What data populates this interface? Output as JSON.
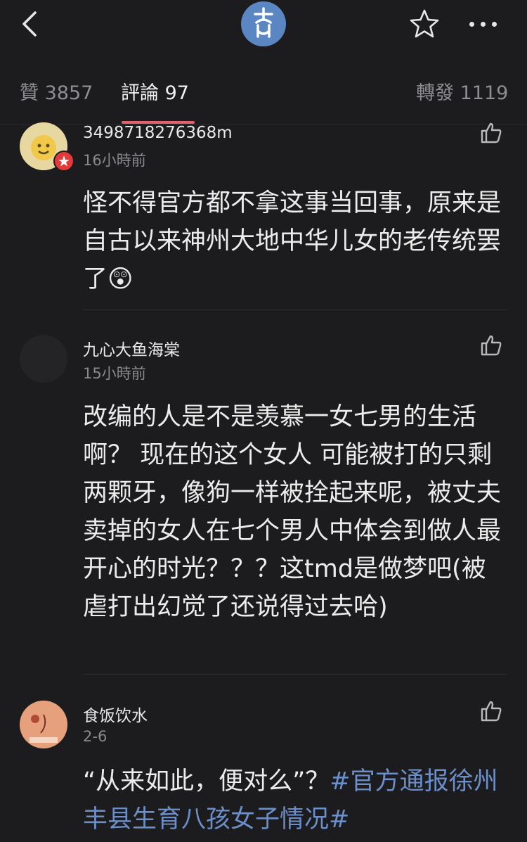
{
  "header": {
    "back_icon": "chevron-left-icon",
    "logo_icon": "weibo-logo-icon",
    "favorite_icon": "star-outline-icon",
    "more_icon": "more-horizontal-icon"
  },
  "tabs": [
    {
      "label": "贊 3857"
    },
    {
      "label": "評論 97"
    },
    {
      "label": "轉發 1119"
    }
  ],
  "colors": {
    "accent": "#e0606e",
    "hashtag": "#6c8fc9",
    "background": "#1c1c1e"
  },
  "comments": [
    {
      "username": "3498718276368m",
      "time": "16小時前",
      "text": "怪不得官方都不拿这事当回事，原来是自古以来神州大地中华儿女的老传统罢了",
      "emoji": "😲"
    },
    {
      "username": "九心大鱼海棠",
      "time": "15小時前",
      "text": "改编的人是不是羡慕一女七男的生活啊？ 现在的这个女人 可能被打的只剩两颗牙，像狗一样被拴起来呢，被丈夫卖掉的女人在七个男人中体会到做人最开心的时光？？？这tmd是做梦吧(被虐打出幻觉了还说得过去哈)"
    },
    {
      "username": "食饭饮水",
      "time": "2-6",
      "text": "“从来如此，便对么”？",
      "hashtag": "#官方通报徐州丰县生育八孩女子情况#"
    }
  ]
}
